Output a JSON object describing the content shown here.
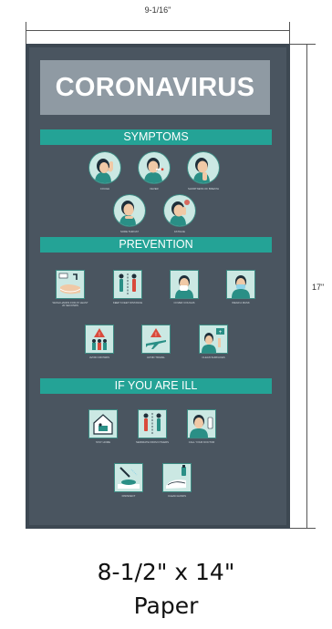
{
  "dimensions": {
    "width_label": "9-1/16\"",
    "height_label": "17\""
  },
  "poster": {
    "title": "CORONAVIRUS",
    "sections": [
      {
        "heading": "SYMPTOMS",
        "captions": [
          "COUGH",
          "FEVER",
          "SHORTNESS OF BREATH",
          "SORE THROAT",
          "FATIGUE"
        ],
        "icons": [
          "cough-icon",
          "fever-icon",
          "shortness-of-breath-icon",
          "sore-throat-icon",
          "fatigue-icon"
        ]
      },
      {
        "heading": "PREVENTION",
        "captions": [
          "WASH HANDS FOR AT LEAST 20 SECONDS",
          "KEEP 6 FEET DISTANCE",
          "COVER COUGHS",
          "WEAR A MASK",
          "AVOID CROWDS",
          "AVOID TRAVEL",
          "CLEAN SURFACES"
        ],
        "icons": [
          "hand-washing-icon",
          "social-distance-icon",
          "cover-cough-icon",
          "face-mask-icon",
          "avoid-crowds-icon",
          "avoid-travel-icon",
          "clean-surfaces-icon"
        ]
      },
      {
        "heading": "IF YOU ARE ILL",
        "captions": [
          "STAY HOME",
          "SEPARATE FROM OTHERS",
          "CALL YOUR DOCTOR",
          "DISINFECT",
          "CLEAN HANDS"
        ],
        "icons": [
          "stay-home-icon",
          "separate-icon",
          "call-doctor-icon",
          "disinfect-icon",
          "clean-hands-icon"
        ]
      }
    ]
  },
  "size_label": "8-1/2\" x 14\"",
  "paper_label": "Paper",
  "colors": {
    "poster_bg": "#4a5560",
    "accent": "#24a396",
    "title_box": "#8f9aa3",
    "icon_bg": "#cbe8e3"
  }
}
